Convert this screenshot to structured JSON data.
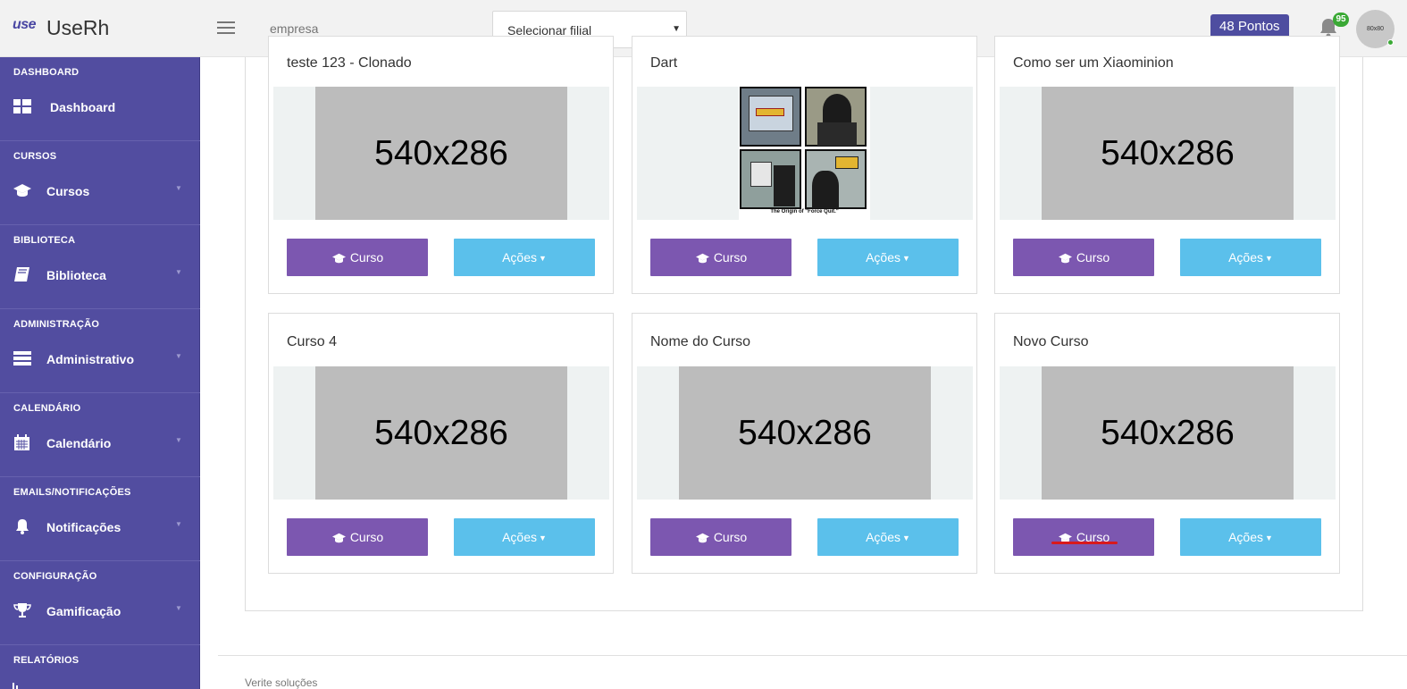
{
  "app": {
    "logo_mark": "use",
    "name": "UseRh"
  },
  "topbar": {
    "company_placeholder": "empresa",
    "branch_select": "Selecionar filial",
    "points": "48 Pontos",
    "notification_count": "95",
    "avatar_text": "80x80"
  },
  "sidebar": [
    {
      "section": "DASHBOARD",
      "label": "Dashboard",
      "icon": "grid-icon",
      "has_submenu": false
    },
    {
      "section": "CURSOS",
      "label": "Cursos",
      "icon": "graduation-cap-icon",
      "has_submenu": true
    },
    {
      "section": "BIBLIOTECA",
      "label": "Biblioteca",
      "icon": "book-icon",
      "has_submenu": true
    },
    {
      "section": "ADMINISTRAÇÃO",
      "label": "Administrativo",
      "icon": "server-icon",
      "has_submenu": true
    },
    {
      "section": "CALENDÁRIO",
      "label": "Calendário",
      "icon": "calendar-icon",
      "has_submenu": true
    },
    {
      "section": "EMAILS/NOTIFICAÇÕES",
      "label": "Notificações",
      "icon": "bell-icon",
      "has_submenu": true
    },
    {
      "section": "CONFIGURAÇÃO",
      "label": "Gamificação",
      "icon": "trophy-icon",
      "has_submenu": true
    },
    {
      "section": "RELATÓRIOS",
      "label": "",
      "icon": "",
      "has_submenu": false
    }
  ],
  "courses": [
    {
      "title": "teste 123 - Clonado",
      "image": "540x286",
      "course_button": "Curso",
      "actions_button": "Ações"
    },
    {
      "title": "Dart",
      "image_caption": "The Origin of \"Force Quit.\"",
      "course_button": "Curso",
      "actions_button": "Ações"
    },
    {
      "title": "Como ser um Xiaominion",
      "image": "540x286",
      "course_button": "Curso",
      "actions_button": "Ações"
    },
    {
      "title": "Curso 4",
      "image": "540x286",
      "course_button": "Curso",
      "actions_button": "Ações"
    },
    {
      "title": "Nome do Curso",
      "image": "540x286",
      "course_button": "Curso",
      "actions_button": "Ações"
    },
    {
      "title": "Novo Curso",
      "image": "540x286",
      "course_button": "Curso",
      "actions_button": "Ações"
    }
  ],
  "footer": {
    "text": "Verite soluções"
  },
  "colors": {
    "sidebar": "#524da0",
    "curso_button": "#7c57b0",
    "acoes_button": "#5bc0eb",
    "points_badge": "#4e4da0",
    "badge_green": "#3aa935"
  }
}
